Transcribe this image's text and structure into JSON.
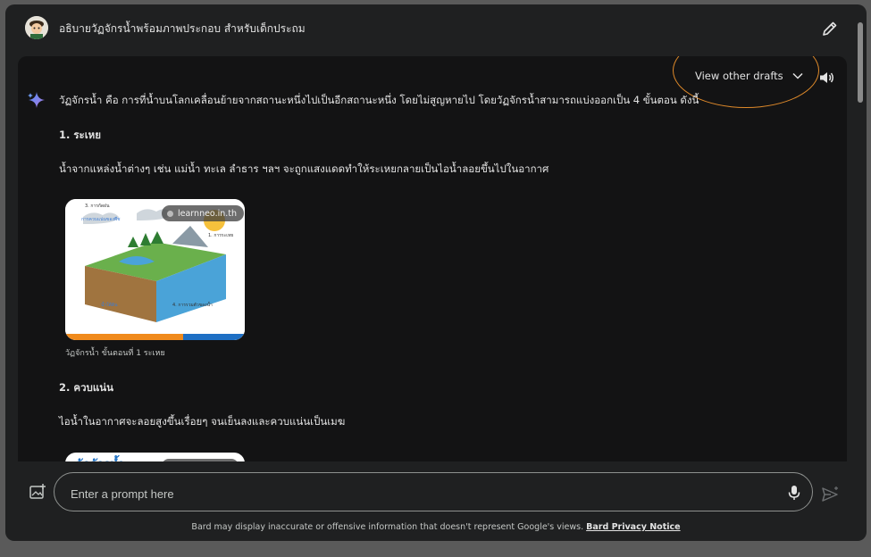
{
  "header": {
    "title": "อธิบายวัฏจักรน้ำพร้อมภาพประกอบ สำหรับเด็กประถม",
    "avatar_icon": "avatar-icon",
    "edit_icon": "pencil-icon"
  },
  "response": {
    "drafts_label": "View other drafts",
    "intro": "วัฏจักรน้ำ คือ การที่น้ำบนโลกเคลื่อนย้ายจากสถานะหนึ่งไปเป็นอีกสถานะหนึ่ง โดยไม่สูญหายไป โดยวัฏจักรน้ำสามารถแบ่งออกเป็น 4 ขั้นตอน ดังนี้",
    "step1_heading": "1. ระเหย",
    "step1_text": "น้ำจากแหล่งน้ำต่างๆ เช่น แม่น้ำ ทะเล ลำธาร ฯลฯ จะถูกแสงแดดทำให้ระเหยกลายเป็นไอน้ำลอยขึ้นไปในอากาศ",
    "image1": {
      "source": "learnneo.in.th",
      "caption": "วัฏจักรน้ำ ขั้นตอนที่ 1 ระเหย",
      "labels": [
        "3. การกัดฝน",
        "การควบแน่นของพืช",
        "1. การระเหย",
        "น้ำใต้ดิน",
        "4. การรวมตัวของน้ำ"
      ]
    },
    "step2_heading": "2. ควบแน่น",
    "step2_text": "ไอน้ำในอากาศจะลอยสูงขึ้นเรื่อยๆ จนเย็นลงและควบแน่นเป็นเมฆ",
    "image2": {
      "title": "วัฏจักรน้ำ"
    }
  },
  "input": {
    "placeholder": "Enter a prompt here"
  },
  "footer": {
    "text": "Bard may display inaccurate or offensive information that doesn't represent Google's views.",
    "link": "Bard Privacy Notice"
  },
  "colors": {
    "background": "#1f2021",
    "panel": "#131314",
    "annotation": "#e08a2a"
  }
}
